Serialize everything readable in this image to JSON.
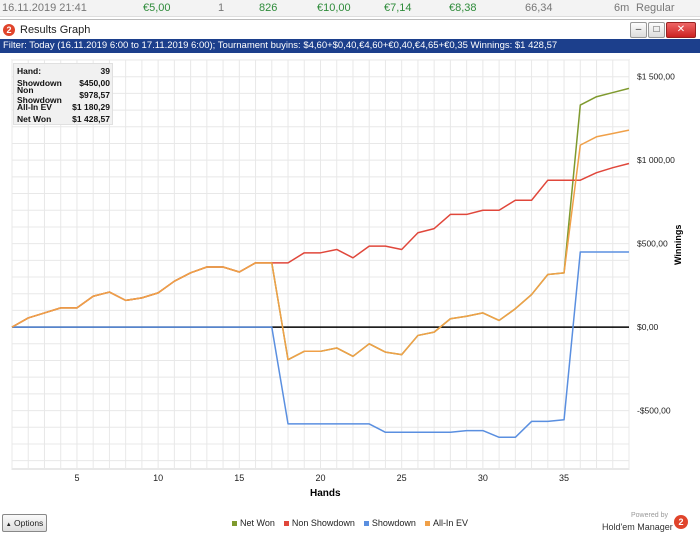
{
  "background_row": {
    "date": "16.11.2019 21:41",
    "buyin": "€5,00",
    "count": "1",
    "hands": "826",
    "won": "€10,00",
    "v1": "€7,14",
    "v2": "€8,38",
    "v3": "66,34",
    "duration": "6m",
    "type": "Regular"
  },
  "window": {
    "title": "Results Graph",
    "minimize": "–",
    "maximize": "□",
    "close": "✕",
    "app_icon": "2"
  },
  "filter_text": "Filter: Today (16.11.2019 6:00 to 17.11.2019 6:00); Tournament buyins: $4,60+$0,40,€4,60+€0,40,€4,65+€0,35 Winnings: $1 428,57",
  "stats": [
    {
      "label": "Hand:",
      "value": "39"
    },
    {
      "label": "Showdown",
      "value": "$450,00"
    },
    {
      "label": "Non Showdown",
      "value": "$978,57"
    },
    {
      "label": "All-In EV",
      "value": "$1 180,29"
    },
    {
      "label": "Net Won",
      "value": "$1 428,57"
    }
  ],
  "bottom": {
    "options_label": "Options",
    "options_icon": "triangle-up-icon",
    "powered_by": "Powered by",
    "brand": "Hold'em Manager",
    "brand_icon": "2"
  },
  "chart_data": {
    "type": "line",
    "xlabel": "Hands",
    "ylabel": "Winnings",
    "xlim": [
      1,
      39
    ],
    "ylim": [
      -850,
      1600
    ],
    "x_ticks": [
      5,
      10,
      15,
      20,
      25,
      30,
      35
    ],
    "y_ticks": [
      -500,
      0,
      500,
      1000,
      1500
    ],
    "y_tick_labels": [
      "-$500,00",
      "$0,00",
      "$500,00",
      "$1 000,00",
      "$1 500,00"
    ],
    "grid": true,
    "legend_position": "bottom",
    "x": [
      1,
      2,
      3,
      4,
      5,
      6,
      7,
      8,
      9,
      10,
      11,
      12,
      13,
      14,
      15,
      16,
      17,
      18,
      19,
      20,
      21,
      22,
      23,
      24,
      25,
      26,
      27,
      28,
      29,
      30,
      31,
      32,
      33,
      34,
      35,
      36,
      37,
      38,
      39
    ],
    "series": [
      {
        "name": "Net Won",
        "color": "#7f9a2e",
        "values": [
          0,
          55,
          85,
          115,
          115,
          185,
          210,
          160,
          175,
          205,
          275,
          325,
          360,
          360,
          330,
          385,
          385,
          -195,
          -145,
          -145,
          -125,
          -175,
          -100,
          -150,
          -165,
          -50,
          -30,
          50,
          65,
          85,
          40,
          110,
          195,
          315,
          325,
          1330,
          1380,
          1405,
          1430
        ]
      },
      {
        "name": "Non Showdown",
        "color": "#e0473b",
        "values": [
          0,
          55,
          85,
          115,
          115,
          185,
          210,
          160,
          175,
          205,
          275,
          325,
          360,
          360,
          330,
          385,
          385,
          385,
          445,
          445,
          465,
          415,
          485,
          485,
          465,
          565,
          590,
          675,
          675,
          700,
          700,
          760,
          760,
          880,
          880,
          880,
          925,
          955,
          980
        ]
      },
      {
        "name": "Showdown",
        "color": "#5a8fe0",
        "values": [
          0,
          0,
          0,
          0,
          0,
          0,
          0,
          0,
          0,
          0,
          0,
          0,
          0,
          0,
          0,
          0,
          0,
          -580,
          -580,
          -580,
          -580,
          -580,
          -580,
          -630,
          -630,
          -630,
          -630,
          -630,
          -620,
          -620,
          -660,
          -660,
          -565,
          -565,
          -555,
          450,
          450,
          450,
          450
        ]
      },
      {
        "name": "All-In EV",
        "color": "#f0a048",
        "values": [
          0,
          55,
          85,
          115,
          115,
          185,
          210,
          160,
          175,
          205,
          275,
          325,
          360,
          360,
          330,
          385,
          385,
          -195,
          -145,
          -145,
          -125,
          -175,
          -100,
          -150,
          -165,
          -50,
          -30,
          50,
          65,
          85,
          40,
          110,
          195,
          315,
          325,
          1090,
          1140,
          1160,
          1180
        ]
      }
    ]
  }
}
